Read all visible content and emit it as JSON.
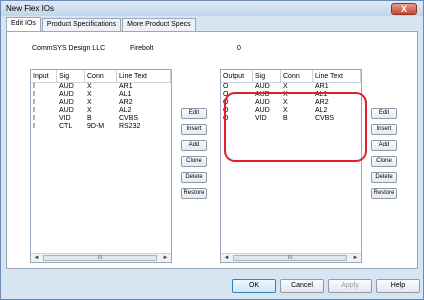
{
  "window": {
    "title": "New Flex IOs",
    "close_label": "X"
  },
  "tabs": [
    {
      "label": "Edit IOs"
    },
    {
      "label": "Product Specifications"
    },
    {
      "label": "More Product Specs"
    }
  ],
  "header": {
    "company": "CommSYS Design LLC",
    "product": "Firebolt",
    "count": "0"
  },
  "inputs_list": {
    "columns": [
      "Input",
      "Sig",
      "Conn",
      "Line Text"
    ],
    "rows": [
      [
        "I",
        "AUD",
        "X",
        "AR1"
      ],
      [
        "I",
        "AUD",
        "X",
        "AL1"
      ],
      [
        "I",
        "AUD",
        "X",
        "AR2"
      ],
      [
        "I",
        "AUD",
        "X",
        "AL2"
      ],
      [
        "I",
        "VID",
        "B",
        "CVBS"
      ],
      [
        "I",
        "CTL",
        "9D-M",
        "RS232"
      ]
    ]
  },
  "outputs_list": {
    "columns": [
      "Output",
      "Sig",
      "Conn",
      "Line Text"
    ],
    "rows": [
      [
        "O",
        "AUD",
        "X",
        "AR1"
      ],
      [
        "O",
        "AUD",
        "X",
        "AL1"
      ],
      [
        "O",
        "AUD",
        "X",
        "AR2"
      ],
      [
        "O",
        "AUD",
        "X",
        "AL2"
      ],
      [
        "O",
        "VID",
        "B",
        "CVBS"
      ]
    ]
  },
  "side_buttons": [
    "Edit",
    "Insert",
    "Add",
    "Clone",
    "Delete",
    "Restore"
  ],
  "scrollbar": {
    "left_arrow": "◄",
    "right_arrow": "►",
    "grip": "III"
  },
  "footer": {
    "ok": "OK",
    "cancel": "Cancel",
    "apply": "Apply",
    "help": "Help"
  },
  "colors": {
    "highlight": "#e0202a",
    "window_bg": "#d7e4f2"
  }
}
